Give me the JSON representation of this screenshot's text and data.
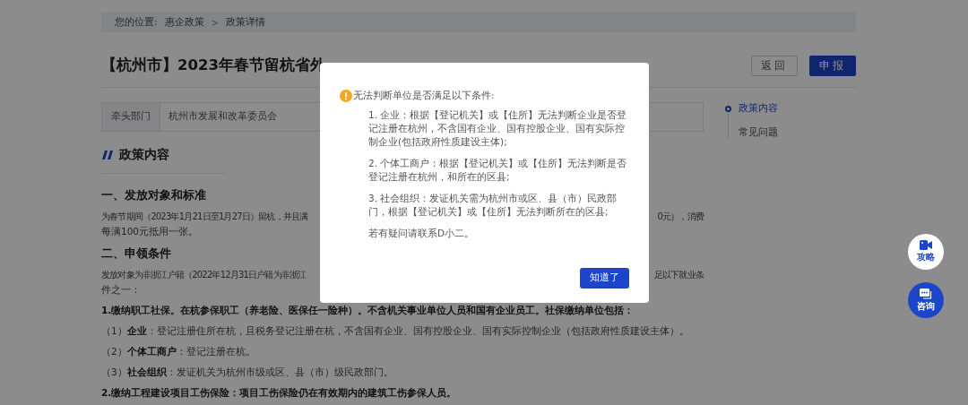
{
  "breadcrumb": {
    "label": "您的位置:",
    "separator": ">",
    "items": [
      {
        "text": "惠企政策"
      },
      {
        "text": "政策详情"
      }
    ]
  },
  "title": "【杭州市】2023年春节留杭省外",
  "actions": [
    {
      "kind": "secondary",
      "label": "返回"
    },
    {
      "kind": "primary",
      "label": "申报"
    }
  ],
  "info_table": {
    "label": "牵头部门",
    "value": "杭州市发展和改革委员会"
  },
  "toc": [
    {
      "label": "政策内容",
      "selected": true
    },
    {
      "label": "常见问题",
      "selected": false
    }
  ],
  "section_title": "政策内容",
  "content": [
    {
      "kind": "heading",
      "text": "一、发放对象和标准"
    },
    {
      "kind": "split",
      "left": "为春节期间（2023年1月21日至1月27日）留杭，并且满",
      "right": "0元），消费"
    },
    {
      "kind": "para",
      "text": "每满100元抵用一张。"
    },
    {
      "kind": "heading",
      "text": "二、申领条件"
    },
    {
      "kind": "split",
      "left": "发放对象为非浙江户籍（2022年12月31日户籍为非浙江",
      "right": "足以下就业条"
    },
    {
      "kind": "para",
      "text": "件之一："
    },
    {
      "kind": "bold",
      "text": "1.缴纳职工社保。在杭参保职工（养老险、医保任一险种）。不含机关事业单位人员和国有企业员工。社保缴纳单位包括："
    },
    {
      "kind": "item",
      "text": "（1）**企业**：登记注册住所在杭，且税务登记注册在杭，不含国有企业、国有控股企业、国有实际控制企业（包括政府性质建设主体）。"
    },
    {
      "kind": "item",
      "text": "（2）**个体工商户**：登记注册在杭。"
    },
    {
      "kind": "item",
      "text": "（3）**社会组织**：发证机关为杭州市级或区、县（市）级民政部门。"
    },
    {
      "kind": "bold",
      "text": "2.缴纳工程建设项目工伤保险：项目工伤保险仍在有效期内的建筑工伤参保人员。"
    }
  ],
  "float_buttons": [
    {
      "kind": "light",
      "label": "攻略"
    },
    {
      "kind": "dark",
      "label": "咨询"
    }
  ],
  "dialog": {
    "heading": "无法判断单位是否满足以下条件:",
    "items": [
      "1. 企业：根据【登记机关】或【住所】无法判断企业是否登记注册在杭州，不含国有企业、国有控股企业、国有实际控制企业(包括政府性质建设主体);",
      "2. 个体工商户：根据【登记机关】或【住所】无法判断是否登记注册在杭州，和所在的区县;",
      "3. 社会组织：发证机关需为杭州市或区、县（市）民政部门，根据【登记机关】或【住所】无法判断所在的区县;",
      "若有疑问请联系D小二。"
    ],
    "button": "知道了"
  }
}
